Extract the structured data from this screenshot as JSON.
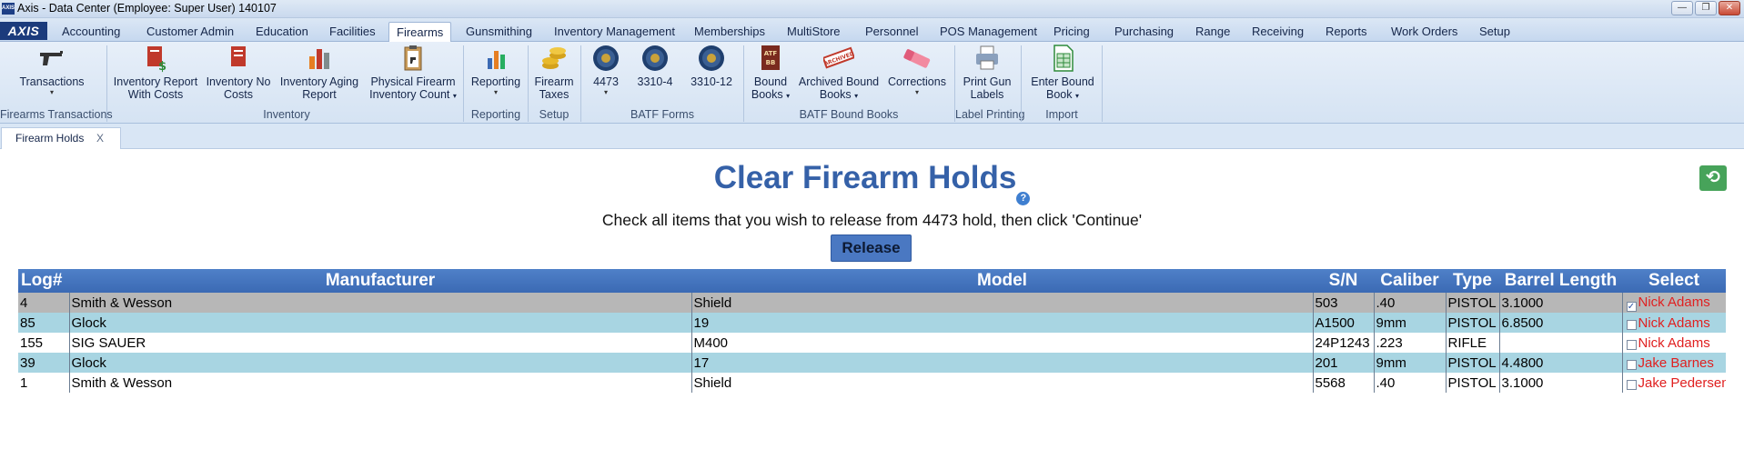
{
  "window": {
    "icon_label": "AXIS",
    "title": "Axis - Data Center  (Employee: Super User) 140107",
    "minimize": "—",
    "maximize": "❐",
    "close": "✕"
  },
  "menu": {
    "logo": "AXIS",
    "tabs": [
      {
        "label": "Accounting"
      },
      {
        "label": "Customer Admin"
      },
      {
        "label": "Education"
      },
      {
        "label": "Facilities"
      },
      {
        "label": "Firearms",
        "active": true
      },
      {
        "label": "Gunsmithing"
      },
      {
        "label": "Inventory Management"
      },
      {
        "label": "Memberships"
      },
      {
        "label": "MultiStore"
      },
      {
        "label": "Personnel"
      },
      {
        "label": "POS Management"
      },
      {
        "label": "Pricing"
      },
      {
        "label": "Purchasing"
      },
      {
        "label": "Range"
      },
      {
        "label": "Receiving"
      },
      {
        "label": "Reports"
      },
      {
        "label": "Work Orders"
      },
      {
        "label": "Setup"
      }
    ]
  },
  "ribbon": {
    "items": [
      {
        "line1": "Transactions",
        "line2": "",
        "arrow": "▾",
        "icon": "pistol-icon"
      },
      {
        "line1": "Inventory Report",
        "line2": "With Costs",
        "arrow": "",
        "icon": "cost-report-icon"
      },
      {
        "line1": "Inventory No",
        "line2": "Costs",
        "arrow": "",
        "icon": "no-cost-report-icon"
      },
      {
        "line1": "Inventory Aging",
        "line2": "Report",
        "arrow": "",
        "icon": "aging-report-icon"
      },
      {
        "line1": "Physical Firearm",
        "line2": "Inventory Count",
        "arrow": "▾",
        "icon": "clipboard-icon"
      },
      {
        "line1": "Reporting",
        "line2": "",
        "arrow": "▾",
        "icon": "bar-chart-icon"
      },
      {
        "line1": "Firearm",
        "line2": "Taxes",
        "arrow": "",
        "icon": "coins-icon"
      },
      {
        "line1": "4473",
        "line2": "",
        "arrow": "▾",
        "icon": "seal-icon"
      },
      {
        "line1": "3310-4",
        "line2": "",
        "arrow": "",
        "icon": "seal-icon"
      },
      {
        "line1": "3310-12",
        "line2": "",
        "arrow": "",
        "icon": "seal-icon"
      },
      {
        "line1": "Bound",
        "line2": "Books",
        "arrow": "▾",
        "icon": "bound-book-icon",
        "badge": "ATF BB"
      },
      {
        "line1": "Archived Bound",
        "line2": "Books",
        "arrow": "▾",
        "icon": "archived-stamp-icon",
        "badge": "ARCHIVED"
      },
      {
        "line1": "Corrections",
        "line2": "",
        "arrow": "▾",
        "icon": "eraser-icon"
      },
      {
        "line1": "Print Gun",
        "line2": "Labels",
        "arrow": "",
        "icon": "printer-icon"
      },
      {
        "line1": "Enter Bound",
        "line2": "Book",
        "arrow": "▾",
        "icon": "spreadsheet-icon"
      }
    ],
    "groups": [
      {
        "label": "Firearms Transactions"
      },
      {
        "label": "Inventory"
      },
      {
        "label": "Reporting"
      },
      {
        "label": "Setup"
      },
      {
        "label": "BATF Forms"
      },
      {
        "label": "BATF Bound Books"
      },
      {
        "label": "Label Printing"
      },
      {
        "label": "Import"
      }
    ]
  },
  "doc_tab": {
    "label": "Firearm Holds",
    "close": "X"
  },
  "page": {
    "title": "Clear Firearm Holds",
    "help": "?",
    "refresh": "⟲",
    "instructions": "Check all items that you wish to release from 4473 hold, then click 'Continue'",
    "release_label": "Release"
  },
  "table": {
    "headers": [
      "Log#",
      "Manufacturer",
      "Model",
      "S/N",
      "Caliber",
      "Type",
      "Barrel Length",
      "Select"
    ],
    "rows": [
      {
        "log": "4",
        "manufacturer": "Smith & Wesson",
        "model": "Shield",
        "sn": "503",
        "caliber": ".40",
        "type": "PISTOL",
        "barrel": "3.1000",
        "checked": true,
        "employee": "Nick Adams",
        "style": "r-sel"
      },
      {
        "log": "85",
        "manufacturer": "Glock",
        "model": "19",
        "sn": "A1500",
        "caliber": "9mm",
        "type": "PISTOL",
        "barrel": "6.8500",
        "checked": false,
        "employee": "Nick Adams",
        "style": "r-alt"
      },
      {
        "log": "155",
        "manufacturer": "SIG SAUER",
        "model": "M400",
        "sn": "24P1243",
        "caliber": ".223",
        "type": "RIFLE",
        "barrel": "",
        "checked": false,
        "employee": "Nick Adams",
        "style": "r-white"
      },
      {
        "log": "39",
        "manufacturer": "Glock",
        "model": "17",
        "sn": "201",
        "caliber": "9mm",
        "type": "PISTOL",
        "barrel": "4.4800",
        "checked": false,
        "employee": "Jake  Barnes",
        "style": "r-alt"
      },
      {
        "log": "1",
        "manufacturer": "Smith & Wesson",
        "model": "Shield",
        "sn": "5568",
        "caliber": ".40",
        "type": "PISTOL",
        "barrel": "3.1000",
        "checked": false,
        "employee": "Jake Pedersen",
        "style": "r-white"
      }
    ]
  },
  "colors": {
    "title_blue": "#3561a8",
    "header_blue": "#3b6ab4",
    "row_selected": "#b7b7b7",
    "row_alt": "#a8d5e2",
    "employee_red": "#e02020",
    "refresh_green": "#47a35a"
  }
}
